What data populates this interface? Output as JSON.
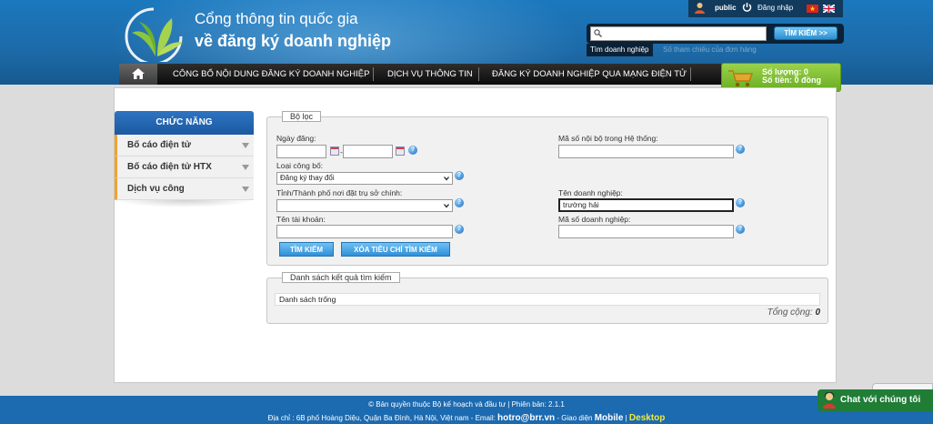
{
  "header": {
    "title_line1": "Cổng thông tin quốc gia",
    "title_line2": "về đăng ký doanh nghiệp",
    "user_name": "public",
    "login_label": "Đăng nhập",
    "search": {
      "placeholder": "",
      "button_label": "TÌM KIẾM >>",
      "tab_active": "Tìm doanh nghiệp",
      "tab_inactive": "Số tham chiếu của đơn hàng"
    }
  },
  "nav": {
    "items": [
      "CÔNG BỐ NỘI DUNG ĐĂNG KÝ DOANH NGHIỆP",
      "DỊCH VỤ THÔNG TIN",
      "ĐĂNG KÝ DOANH NGHIỆP QUA MẠNG ĐIỆN TỬ"
    ]
  },
  "cart": {
    "quantity_text": "Số lượng: 0",
    "total_text": "Số tiền: 0 đồng"
  },
  "sidebar": {
    "title": "CHỨC NĂNG",
    "items": [
      "Bố cáo điện tử",
      "Bố cáo điện tử HTX",
      "Dịch vụ công"
    ]
  },
  "filter": {
    "legend": "Bộ lọc",
    "date_label": "Ngày đăng:",
    "date_from": "",
    "date_to": "",
    "type_label": "Loại công bố:",
    "type_value": "Đăng ký thay đổi",
    "province_label": "Tỉnh/Thành phố nơi đặt trụ sở chính:",
    "province_value": "",
    "account_label": "Tên tài khoản:",
    "account_value": "",
    "internal_code_label": "Mã số nội bộ trong Hệ thống:",
    "internal_code_value": "",
    "company_name_label": "Tên doanh nghiệp:",
    "company_name_value": "trường hải",
    "company_code_label": "Mã số doanh nghiệp:",
    "company_code_value": "",
    "search_button": "TÌM KIẾM",
    "clear_button": "XÓA TIÊU CHÍ TÌM KIẾM"
  },
  "results": {
    "legend": "Danh sách kết quả tìm kiếm",
    "empty_text": "Danh sách trống",
    "total_label": "Tổng cộng:",
    "total_value": "0"
  },
  "footer": {
    "line1": "© Bản quyền thuộc Bộ kế hoạch và đầu tư | Phiên bản: 2.1.1",
    "line2_prefix": "Địa chỉ : 6B phố Hoàng Diệu, Quận Ba Đình, Hà Nội, Việt nam - Email: ",
    "email": "hotro@brr.vn",
    "line2_middle": " - Giao diện ",
    "mobile": "Mobile",
    "separator": " | ",
    "desktop": "Desktop"
  },
  "chat": {
    "label": "Chat với chúng tôi"
  },
  "colors": {
    "header_blue": "#1d6aa8",
    "nav_black": "#111111",
    "cart_green": "#7fbf33",
    "sidebar_accent": "#f1a22b",
    "button_blue": "#2f8fd6",
    "chat_green": "#1f7d36",
    "desktop_yellow": "#f2e93d"
  }
}
